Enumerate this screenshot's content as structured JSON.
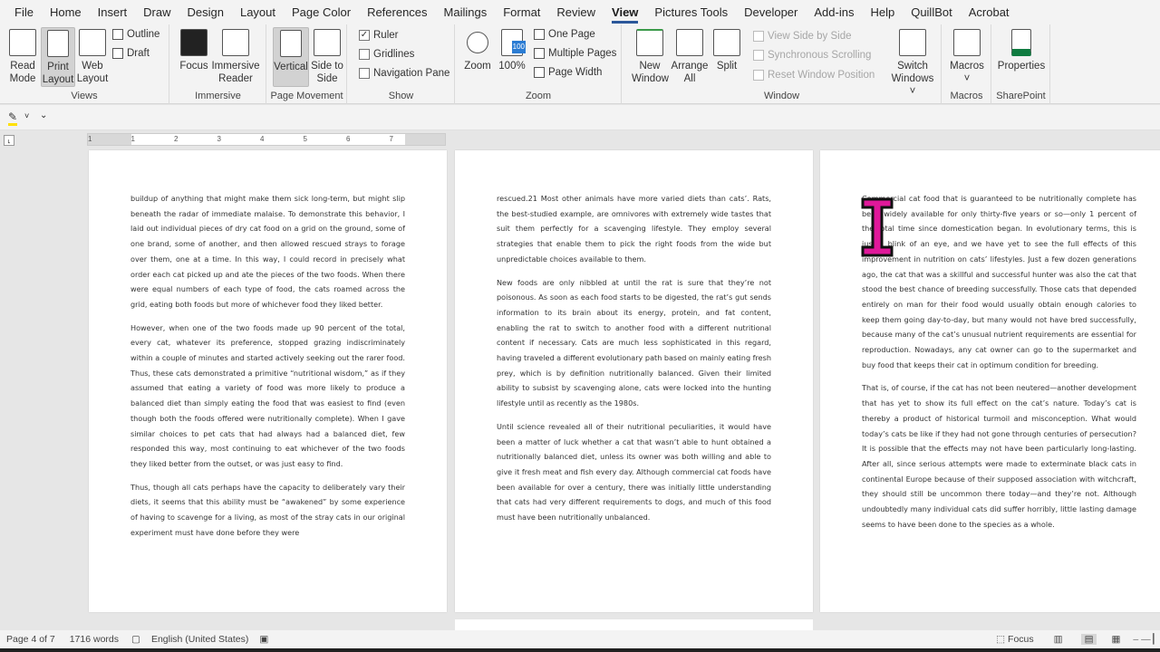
{
  "menu": [
    "File",
    "Home",
    "Insert",
    "Draw",
    "Design",
    "Layout",
    "Page Color",
    "References",
    "Mailings",
    "Format",
    "Review",
    "View",
    "Pictures Tools",
    "Developer",
    "Add-ins",
    "Help",
    "QuillBot",
    "Acrobat"
  ],
  "active_tab": "View",
  "ribbon": {
    "views": {
      "label": "Views",
      "read_mode": "Read Mode",
      "print_layout": "Print Layout",
      "web_layout": "Web Layout",
      "outline": "Outline",
      "draft": "Draft"
    },
    "immersive": {
      "label": "Immersive",
      "focus": "Focus",
      "reader": "Immersive Reader"
    },
    "page_movement": {
      "label": "Page Movement",
      "vertical": "Vertical",
      "side": "Side to Side"
    },
    "show": {
      "label": "Show",
      "ruler": "Ruler",
      "ruler_checked": true,
      "gridlines": "Gridlines",
      "gridlines_checked": false,
      "nav": "Navigation Pane",
      "nav_checked": false
    },
    "zoom": {
      "label": "Zoom",
      "zoom": "Zoom",
      "hundred": "100%",
      "hundred_badge": "100",
      "one_page": "One Page",
      "multiple": "Multiple Pages",
      "width": "Page Width"
    },
    "window": {
      "label": "Window",
      "new": "New Window",
      "arrange": "Arrange All",
      "split": "Split",
      "side_by_side": "View Side by Side",
      "sync": "Synchronous Scrolling",
      "reset": "Reset Window Position",
      "switch": "Switch Windows"
    },
    "macros": {
      "label": "Macros",
      "macros": "Macros"
    },
    "sharepoint": {
      "label": "SharePoint",
      "properties": "Properties"
    }
  },
  "ruler": {
    "ticks": [
      "1",
      "1",
      "2",
      "3",
      "4",
      "5",
      "6",
      "7"
    ]
  },
  "pages": [
    {
      "paragraphs": [
        "buildup of anything that might make them sick long-term, but might slip beneath the radar of immediate malaise. To demonstrate this behavior, I laid out individual pieces of dry cat food on a grid on the ground, some of one brand, some of another, and then allowed rescued strays to forage over them, one at a time. In this way, I could record in precisely what order each cat picked up and ate the pieces of the two foods. When there were equal numbers of each type of food, the cats roamed across the grid, eating both foods but more of whichever food they liked better.",
        "However, when one of the two foods made up 90 percent of the total, every cat, whatever its preference, stopped grazing indiscriminately within a couple of minutes and started actively seeking out the rarer food. Thus, these cats demonstrated a primitive “nutritional wisdom,” as if they assumed that eating a variety of food was more likely to produce a balanced diet than simply eating the food that was easiest to find (even though both the foods offered were nutritionally complete). When I gave similar choices to pet cats that had always had a balanced diet, few responded this way, most continuing to eat whichever of the two foods they liked better from the outset, or was just easy to find.",
        "Thus, though all cats perhaps have the capacity to deliberately vary their diets, it seems that this ability must be “awakened” by some experience of having to scavenge for a living, as most of the stray cats in our original experiment must have done before they were"
      ]
    },
    {
      "paragraphs": [
        "rescued.21 Most other animals have more varied diets than cats’. Rats, the best-studied example, are omnivores with extremely wide tastes that suit them perfectly for a scavenging lifestyle. They employ several strategies that enable them to pick the right foods from the wide but unpredictable choices available to them.",
        "New foods are only nibbled at until the rat is sure that they’re not poisonous. As soon as each food starts to be digested, the rat’s gut sends information to its brain about its energy, protein, and fat content, enabling the rat to switch to another food with a different nutritional content if necessary. Cats are much less sophisticated in this regard, having traveled a different evolutionary path based on mainly eating fresh prey, which is by definition nutritionally balanced. Given their limited ability to subsist by scavenging alone, cats were locked into the hunting lifestyle until as recently as the 1980s.",
        "Until science revealed all of their nutritional peculiarities, it would have been a matter of luck whether a cat that wasn’t able to hunt obtained a nutritionally balanced diet, unless its owner was both willing and able to give it fresh meat and fish every day. Although commercial cat foods have been available for over a century, there was initially little understanding that cats had very different requirements to dogs, and much of this food must have been nutritionally unbalanced."
      ]
    },
    {
      "paragraphs": [
        "Commercial cat food that is guaranteed to be nutritionally complete has been widely available for only thirty-five years or so—only 1 percent of the total time since domestication began. In evolutionary terms, this is just a blink of an eye, and we have yet to see the full effects of this improvement in nutrition on cats’ lifestyles. Just a few dozen generations ago, the cat that was a skillful and successful hunter was also the cat that stood the best chance of breeding successfully. Those cats that depended entirely on man for their food would usually obtain enough calories to keep them going day-to-day, but many would not have bred successfully, because many of the cat’s unusual nutrient requirements are essential for reproduction. Nowadays, any cat owner can go to the supermarket and buy food that keeps their cat in optimum condition for breeding.",
        "That is, of course, if the cat has not been neutered—another development that has yet to show its full effect on the cat’s nature. Today’s cat is thereby a product of historical turmoil and misconception. What would today’s cats be like if they had not gone through centuries of persecution? It is possible that the effects may not have been particularly long-lasting. After all, since serious attempts were made to exterminate black cats in continental Europe because of their supposed association with witchcraft, they should still be uncommon there today—and they’re not. Although undoubtedly many individual cats did suffer horribly, little lasting damage seems to have been done to the species as a whole."
      ]
    }
  ],
  "status": {
    "page": "Page 4 of 7",
    "words": "1716 words",
    "language": "English (United States)",
    "focus": "Focus"
  },
  "colors": {
    "accent": "#2b579a",
    "cursor": "#e0189a"
  }
}
